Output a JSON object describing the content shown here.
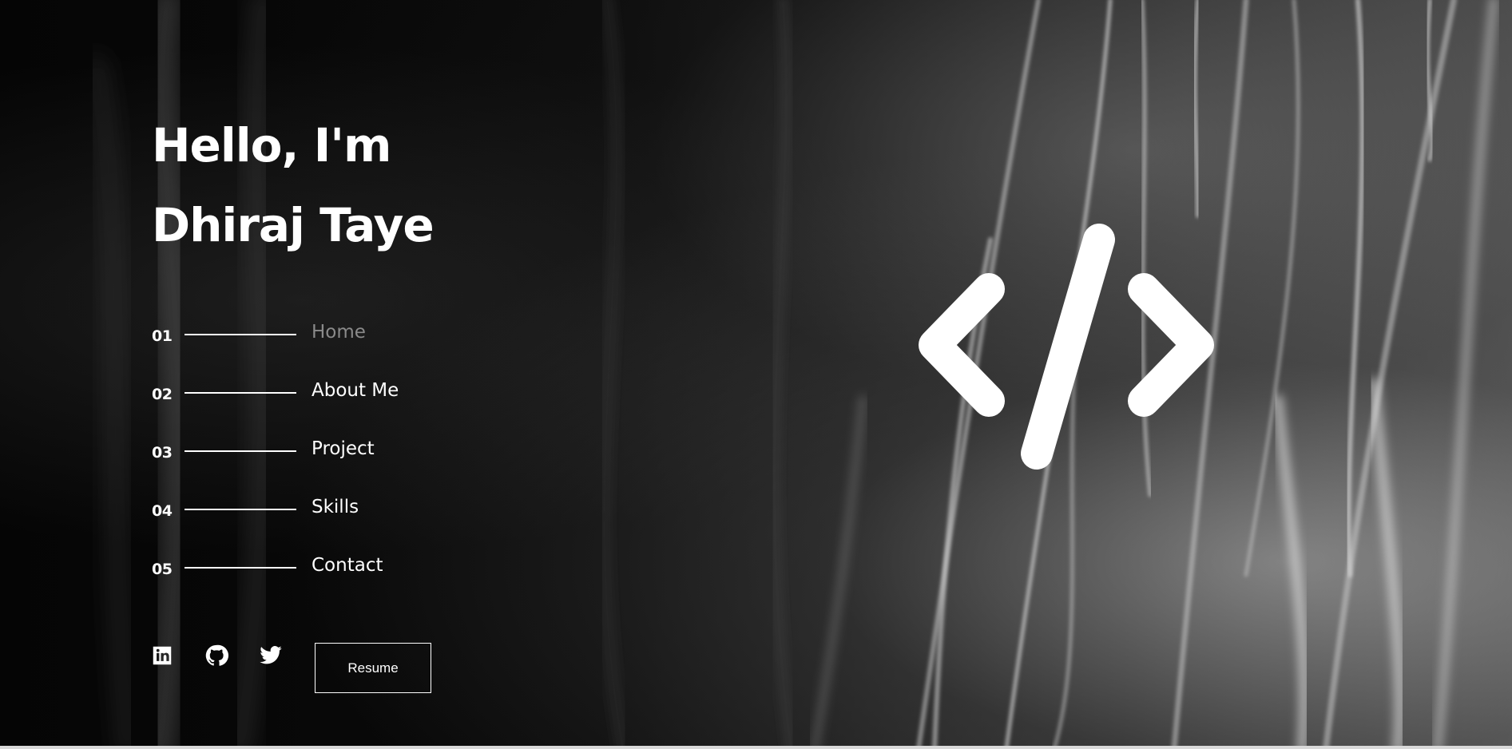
{
  "hero": {
    "line1": "Hello, I'm",
    "line2": "Dhiraj Taye"
  },
  "nav": {
    "items": [
      {
        "num": "01",
        "label": "Home",
        "active": true
      },
      {
        "num": "02",
        "label": "About Me",
        "active": false
      },
      {
        "num": "03",
        "label": "Project",
        "active": false
      },
      {
        "num": "04",
        "label": "Skills",
        "active": false
      },
      {
        "num": "05",
        "label": "Contact",
        "active": false
      }
    ]
  },
  "socials": [
    {
      "icon": "linkedin-icon"
    },
    {
      "icon": "github-icon"
    },
    {
      "icon": "twitter-icon"
    }
  ],
  "resume": {
    "label": "Resume"
  },
  "logo": {
    "icon": "code-brackets-icon"
  },
  "colors": {
    "background": "#000000",
    "text": "#ffffff",
    "active_nav": "#8a8a8a"
  }
}
